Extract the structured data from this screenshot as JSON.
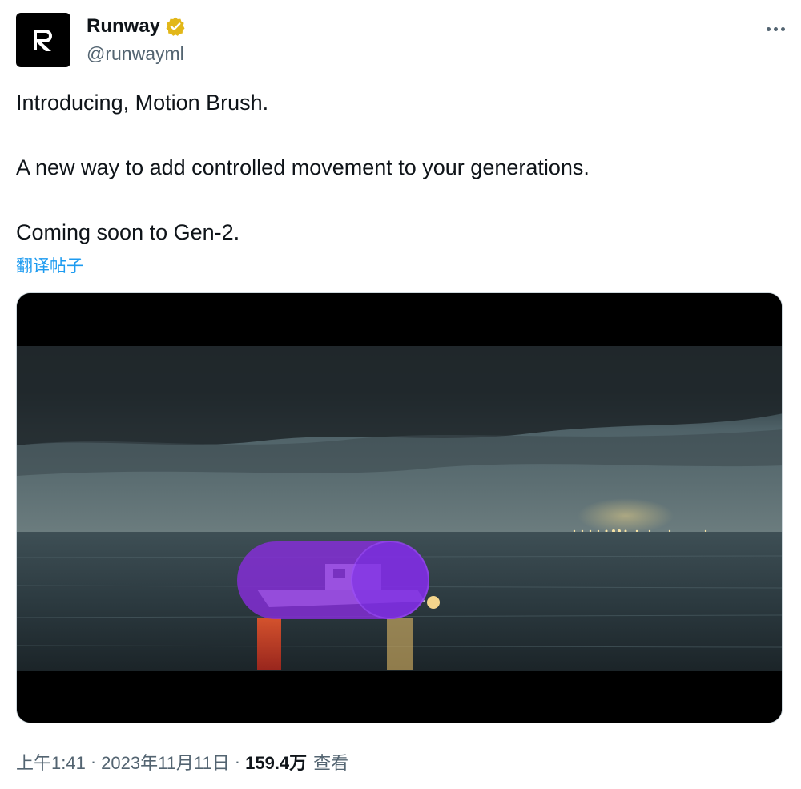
{
  "author": {
    "display_name": "Runway",
    "handle": "@runwayml",
    "verified_badge_color": "#e2b719",
    "avatar_icon": "runway-logo-icon"
  },
  "tweet": {
    "line1": "Introducing, Motion Brush.",
    "line2": "A new way to add controlled movement to your generations.",
    "line3": "Coming soon to Gen-2.",
    "translate_link": "翻译帖子"
  },
  "media": {
    "type": "video",
    "scene": "stormy-sea-boat",
    "brush_color": "#8a2be2"
  },
  "meta": {
    "time": "上午1:41",
    "separator": "·",
    "date": "2023年11月11日",
    "views_count": "159.4万",
    "views_label": "查看"
  },
  "colors": {
    "accent_link": "#1d9bf0",
    "secondary_text": "#536471"
  }
}
